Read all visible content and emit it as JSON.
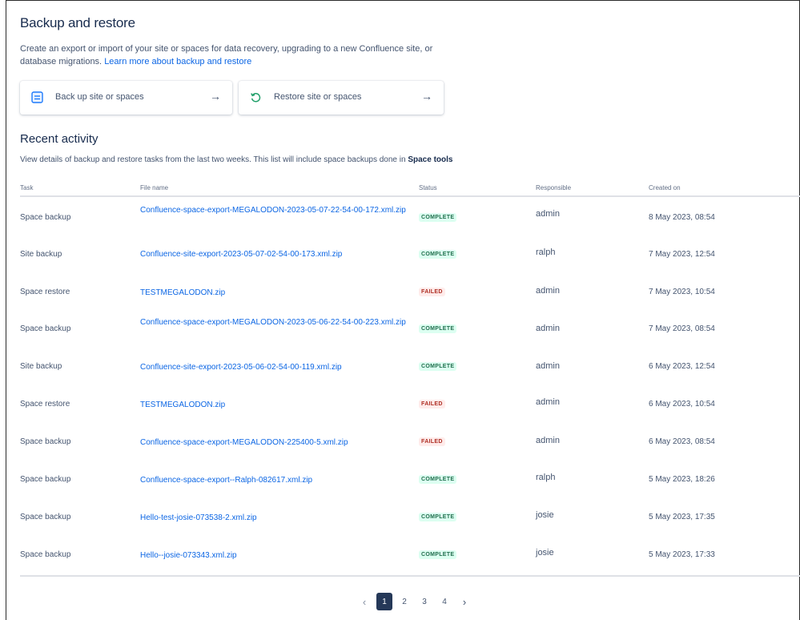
{
  "header": {
    "title": "Backup and restore",
    "description": "Create an export or import of your site or spaces for data recovery, upgrading to a new Confluence site, or database migrations.",
    "learn_more_link": "Learn more about backup and restore"
  },
  "actions": {
    "backup_label": "Back up site or spaces",
    "restore_label": "Restore site or spaces"
  },
  "recent": {
    "title": "Recent activity",
    "description": "View details of backup and restore tasks from the last two weeks. This list will include space backups done in",
    "description_bold": "Space tools"
  },
  "table": {
    "columns": [
      "Task",
      "File name",
      "Status",
      "Responsible",
      "Created on"
    ],
    "rows": [
      {
        "task": "Space backup",
        "file": "Confluence-space-export-MEGALODON-2023-05-07-22-54-00-172.xml.zip",
        "status": "COMPLETE",
        "responsible": "admin",
        "created": "8 May 2023, 08:54"
      },
      {
        "task": "Site backup",
        "file": "Confluence-site-export-2023-05-07-02-54-00-173.xml.zip",
        "status": "COMPLETE",
        "responsible": "ralph",
        "created": "7 May 2023, 12:54"
      },
      {
        "task": "Space restore",
        "file": "TESTMEGALODON.zip",
        "status": "FAILED",
        "responsible": "admin",
        "created": "7 May 2023, 10:54"
      },
      {
        "task": "Space backup",
        "file": "Confluence-space-export-MEGALODON-2023-05-06-22-54-00-223.xml.zip",
        "status": "COMPLETE",
        "responsible": "admin",
        "created": "7 May 2023, 08:54"
      },
      {
        "task": "Site backup",
        "file": "Confluence-site-export-2023-05-06-02-54-00-119.xml.zip",
        "status": "COMPLETE",
        "responsible": "admin",
        "created": "6 May 2023, 12:54"
      },
      {
        "task": "Space restore",
        "file": "TESTMEGALODON.zip",
        "status": "FAILED",
        "responsible": "admin",
        "created": "6 May 2023, 10:54"
      },
      {
        "task": "Space backup",
        "file": "Confluence-space-export-MEGALODON-225400-5.xml.zip",
        "status": "FAILED",
        "responsible": "admin",
        "created": "6 May 2023, 08:54"
      },
      {
        "task": "Space backup",
        "file": "Confluence-space-export--Ralph-082617.xml.zip",
        "status": "COMPLETE",
        "responsible": "ralph",
        "created": "5 May 2023, 18:26"
      },
      {
        "task": "Space backup",
        "file": "Hello-test-josie-073538-2.xml.zip",
        "status": "COMPLETE",
        "responsible": "josie",
        "created": "5 May 2023, 17:35"
      },
      {
        "task": "Space backup",
        "file": "Hello--josie-073343.xml.zip",
        "status": "COMPLETE",
        "responsible": "josie",
        "created": "5 May 2023, 17:33"
      }
    ]
  },
  "pagination": {
    "pages": [
      "1",
      "2",
      "3",
      "4"
    ],
    "current": "1",
    "prev_icon": "chevron-left-icon",
    "next_icon": "chevron-right-icon"
  },
  "colors": {
    "link": "#0c66e4",
    "complete_bg": "#dcfff1",
    "complete_text": "#216e4e",
    "failed_bg": "#ffeceb",
    "failed_text": "#ae2e24",
    "active_page": "#253858"
  }
}
